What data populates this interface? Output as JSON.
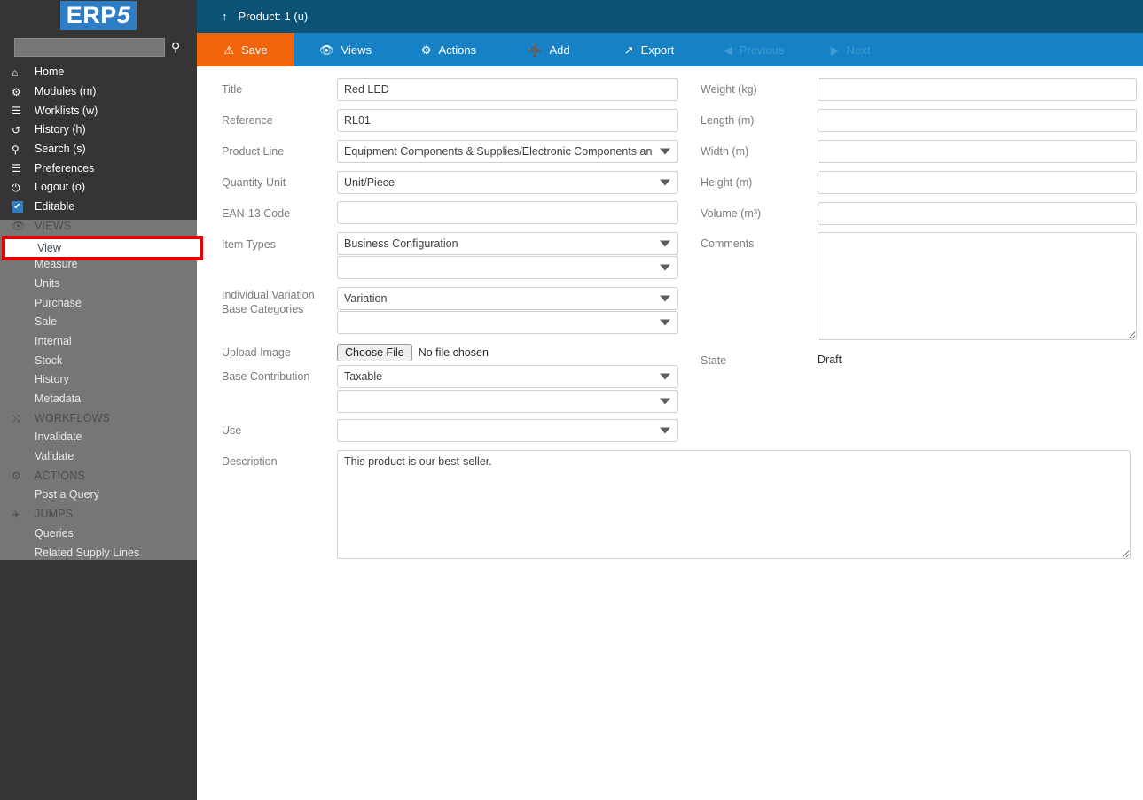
{
  "brand": {
    "logo_text_main": "ERP",
    "logo_text_accent": "5",
    "accent_color": "#2f7dc4"
  },
  "sidebar": {
    "search": {
      "value": "",
      "placeholder": "",
      "icon": "search-icon"
    },
    "main_items": [
      {
        "icon": "home-icon",
        "glyph": "⌂",
        "label": "Home"
      },
      {
        "icon": "modules-icon",
        "glyph": "⚑",
        "label": "Modules (m)"
      },
      {
        "icon": "worklists-icon",
        "glyph": "☰",
        "label": "Worklists (w)"
      },
      {
        "icon": "history-icon",
        "glyph": "↺",
        "label": "History (h)"
      },
      {
        "icon": "search-icon",
        "glyph": "⌕",
        "label": "Search (s)"
      },
      {
        "icon": "preferences-icon",
        "glyph": "☰",
        "label": "Preferences"
      },
      {
        "icon": "power-icon",
        "glyph": "⏻",
        "label": "Logout (o)"
      },
      {
        "icon": "checkbox-checked-icon",
        "glyph": "✔",
        "label": "Editable"
      }
    ],
    "groups": [
      {
        "icon": "eye-icon",
        "glyph": "◉",
        "label": "VIEWS",
        "items": [
          "View",
          "Measure",
          "Units",
          "Purchase",
          "Sale",
          "Internal",
          "Stock",
          "History",
          "Metadata"
        ]
      },
      {
        "icon": "workflows-icon",
        "glyph": "⤨",
        "label": "WORKFLOWS",
        "items": [
          "Invalidate",
          "Validate"
        ]
      },
      {
        "icon": "actions-icon",
        "glyph": "⚙",
        "label": "ACTIONS",
        "items": [
          "Post a Query"
        ]
      },
      {
        "icon": "jumps-icon",
        "glyph": "✈",
        "label": "JUMPS",
        "items": [
          "Queries",
          "Related Supply Lines"
        ]
      }
    ],
    "highlighted_item": "View",
    "highlight_color": "#e50000"
  },
  "header": {
    "up_icon": "arrow-up-icon",
    "glyph": "↑",
    "title": "Product: 1 (u)"
  },
  "toolbar": {
    "save_label": "Save",
    "views_label": "Views",
    "actions_label": "Actions",
    "add_label": "Add",
    "export_label": "Export",
    "previous_label": "Previous",
    "next_label": "Next",
    "save_color": "#f2650a",
    "bar_color": "#1681c4"
  },
  "form": {
    "left": {
      "title": {
        "label": "Title",
        "value": "Red LED"
      },
      "reference": {
        "label": "Reference",
        "value": "RL01"
      },
      "product_line": {
        "label": "Product Line",
        "value": "Equipment Components & Supplies/Electronic Components an"
      },
      "quantity_unit": {
        "label": "Quantity Unit",
        "value": "Unit/Piece"
      },
      "ean13": {
        "label": "EAN-13 Code",
        "value": ""
      },
      "item_types": {
        "label": "Item Types",
        "value": "Business Configuration",
        "value2": ""
      },
      "individual_variation": {
        "label_line1": "Individual Variation",
        "label_line2": "Base Categories",
        "value": "Variation",
        "value2": ""
      },
      "upload_image": {
        "label": "Upload Image",
        "button": "Choose File",
        "status": "No file chosen"
      },
      "base_contribution": {
        "label": "Base Contribution",
        "value": "Taxable",
        "value2": ""
      },
      "use": {
        "label": "Use",
        "value": ""
      },
      "description": {
        "label": "Description",
        "value": "This product is our best-seller."
      }
    },
    "right": {
      "weight": {
        "label": "Weight (kg)",
        "value": ""
      },
      "length": {
        "label": "Length (m)",
        "value": ""
      },
      "width": {
        "label": "Width (m)",
        "value": ""
      },
      "height": {
        "label": "Height (m)",
        "value": ""
      },
      "volume": {
        "label": "Volume (m³)",
        "value": ""
      },
      "comments": {
        "label": "Comments",
        "value": ""
      },
      "state": {
        "label": "State",
        "value": "Draft"
      }
    }
  }
}
